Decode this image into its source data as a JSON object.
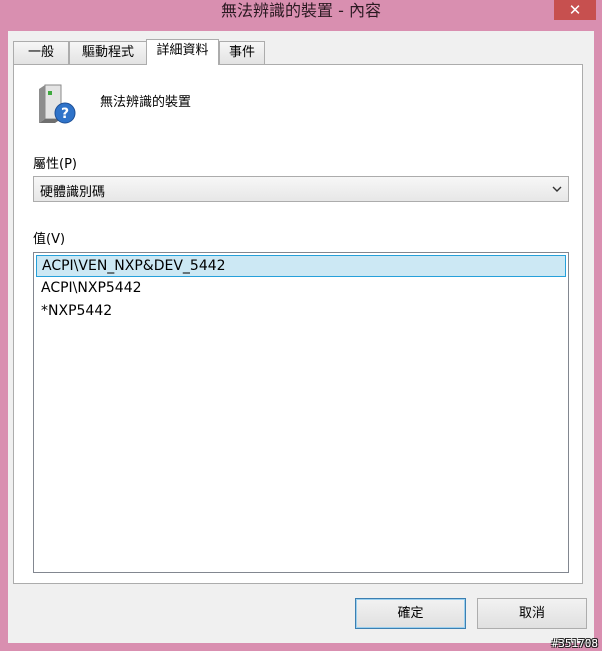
{
  "window": {
    "title": "無法辨識的裝置 - 內容",
    "close_glyph": "✕"
  },
  "tabs": [
    {
      "label": "一般"
    },
    {
      "label": "驅動程式"
    },
    {
      "label": "詳細資料",
      "active": true
    },
    {
      "label": "事件"
    }
  ],
  "device": {
    "name": "無法辨識的裝置",
    "icon": "unknown-device-icon"
  },
  "property": {
    "label": "屬性(P)",
    "selected": "硬體識別碼"
  },
  "value": {
    "label": "值(V)",
    "items": [
      "ACPI\\VEN_NXP&DEV_5442",
      "ACPI\\NXP5442",
      "*NXP5442"
    ],
    "selected_index": 0
  },
  "buttons": {
    "ok": "確定",
    "cancel": "取消"
  },
  "watermark": "#351708",
  "colors": {
    "frame": "#d98fb0",
    "close": "#c7504f",
    "selection": "#cce8f4",
    "selection_border": "#26a0da"
  }
}
